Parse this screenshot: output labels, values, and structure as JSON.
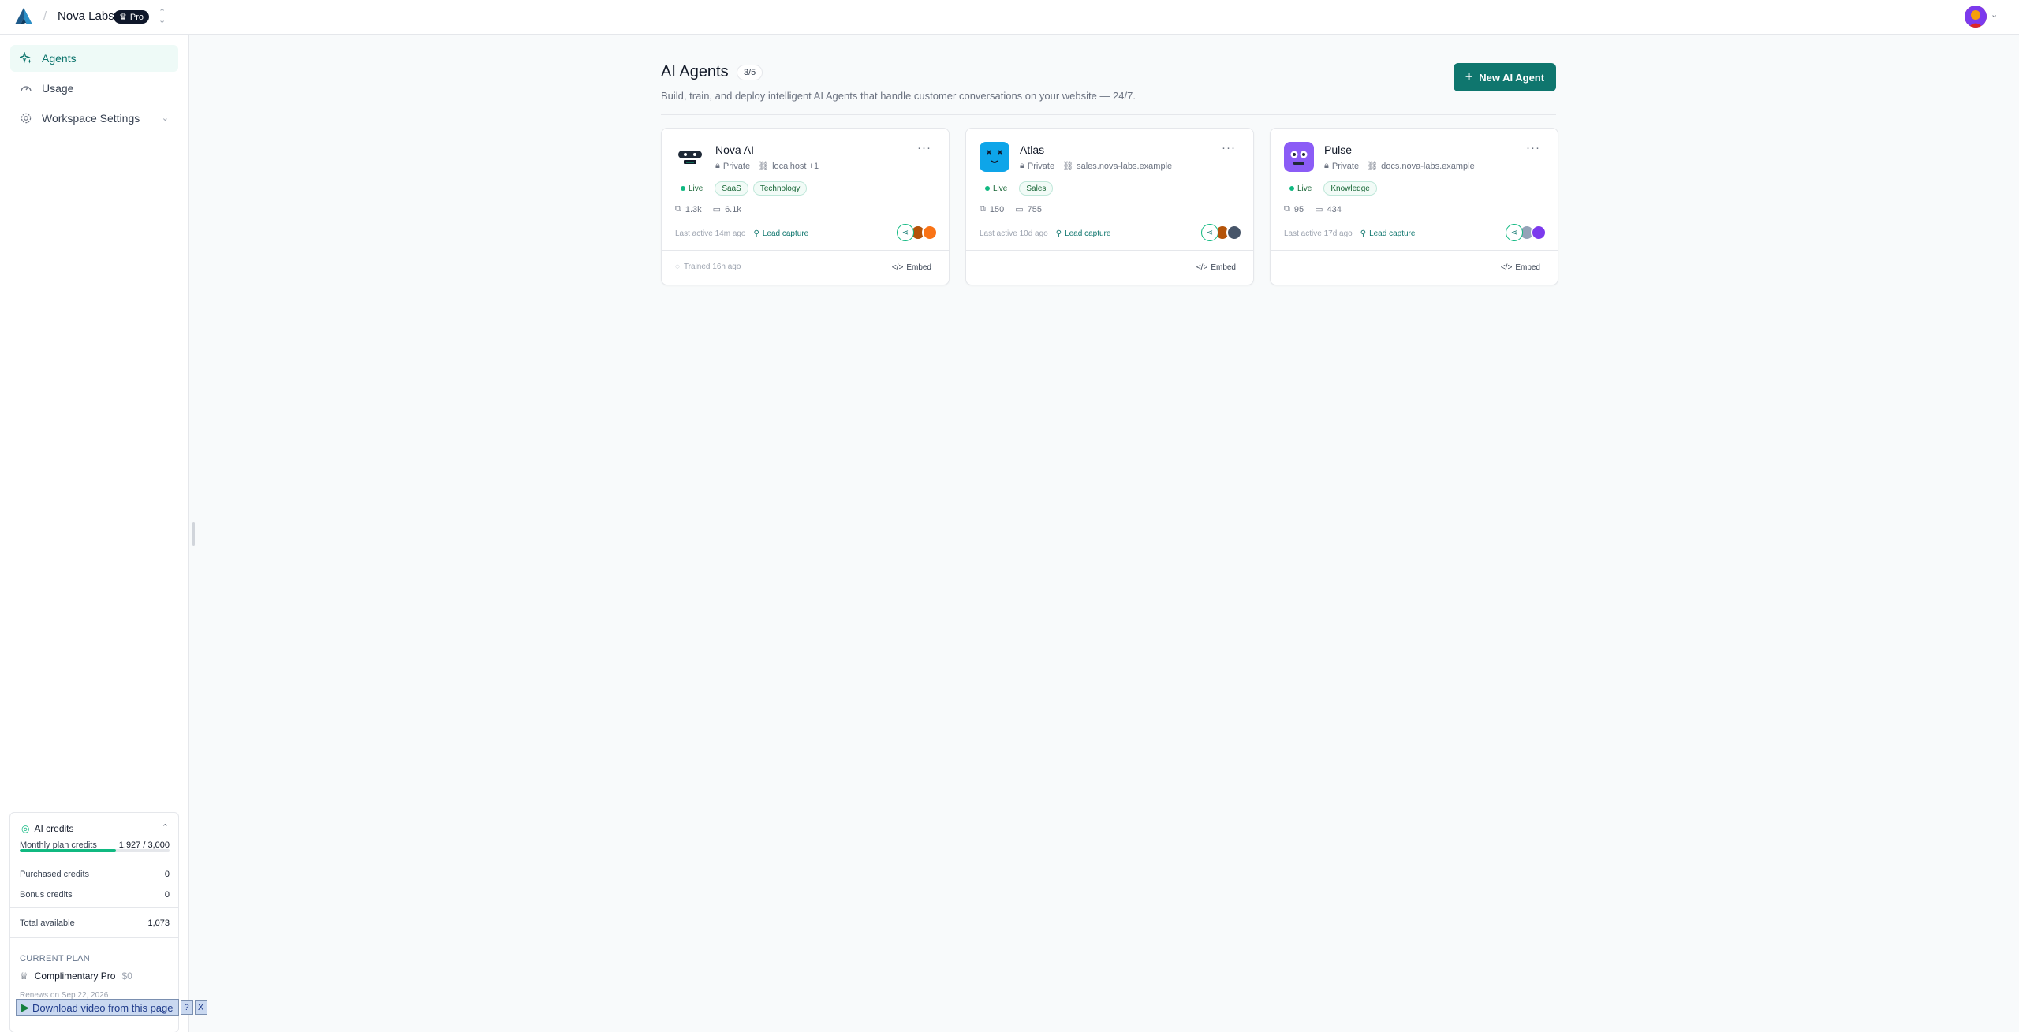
{
  "header": {
    "workspace_name": "Nova Labs",
    "plan_badge": "Pro"
  },
  "sidebar": {
    "items": [
      {
        "label": "Agents",
        "icon": "sparkle-icon",
        "active": true
      },
      {
        "label": "Usage",
        "icon": "gauge-icon",
        "active": false
      },
      {
        "label": "Workspace Settings",
        "icon": "gear-icon",
        "active": false
      }
    ]
  },
  "credits": {
    "title": "AI credits",
    "monthly_label": "Monthly plan credits",
    "monthly_value": "1,927 / 3,000",
    "monthly_fraction": 0.642,
    "purchased_label": "Purchased credits",
    "purchased_value": "0",
    "bonus_label": "Bonus credits",
    "bonus_value": "0",
    "total_label": "Total available",
    "total_value": "1,073",
    "plan_section_label": "CURRENT PLAN",
    "plan_name": "Complimentary Pro",
    "plan_price": "$0",
    "plan_renew": "Renews on Sep 22, 2026"
  },
  "overlay": {
    "download_label": "Download video from this page",
    "help_label": "?",
    "close_label": "X"
  },
  "main": {
    "title": "AI Agents",
    "count": "3/5",
    "subtitle": "Build, train, and deploy intelligent AI Agents that handle customer conversations on your website — 24/7.",
    "new_button": "New AI Agent",
    "agents": [
      {
        "name": "Nova AI",
        "visibility": "Private",
        "domain": "localhost +1",
        "status": "Live",
        "tags": [
          "SaaS",
          "Technology"
        ],
        "conversations": "1.3k",
        "messages": "6.1k",
        "last_active": "Last active 14m ago",
        "lead": "Lead capture",
        "trained": "Trained 16h ago",
        "embed": "Embed",
        "avatar_color": "#1f2937"
      },
      {
        "name": "Atlas",
        "visibility": "Private",
        "domain": "sales.nova-labs.example",
        "status": "Live",
        "tags": [
          "Sales"
        ],
        "conversations": "150",
        "messages": "755",
        "last_active": "Last active 10d ago",
        "lead": "Lead capture",
        "trained": "",
        "embed": "Embed",
        "avatar_color": "#0ea5e9"
      },
      {
        "name": "Pulse",
        "visibility": "Private",
        "domain": "docs.nova-labs.example",
        "status": "Live",
        "tags": [
          "Knowledge"
        ],
        "conversations": "95",
        "messages": "434",
        "last_active": "Last active 17d ago",
        "lead": "Lead capture",
        "trained": "",
        "embed": "Embed",
        "avatar_color": "#8b5cf6"
      }
    ]
  },
  "colors": {
    "accent": "#0f766e",
    "live": "#10b981"
  }
}
